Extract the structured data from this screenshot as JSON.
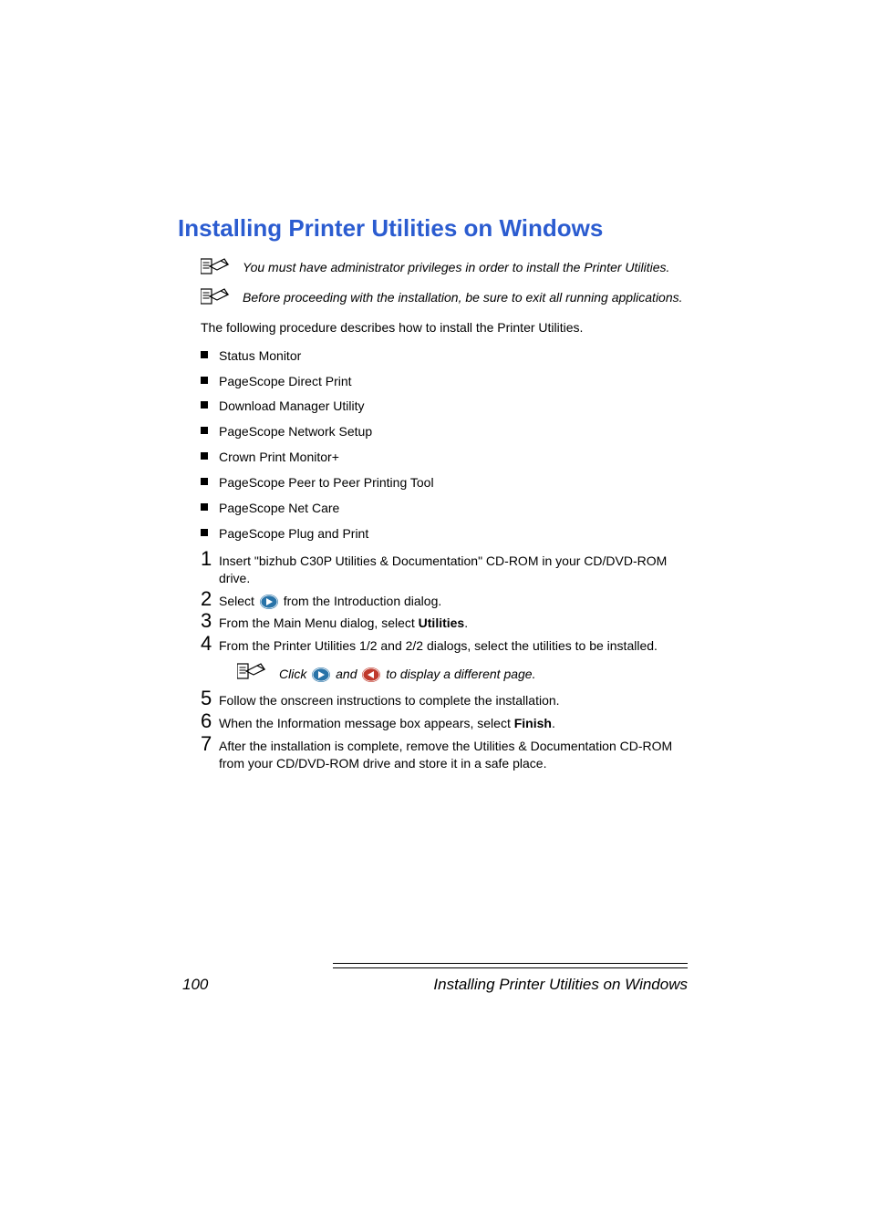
{
  "heading": "Installing Printer Utilities on Windows",
  "notes": {
    "note1": "You must have administrator privileges in order to install the Printer Utilities.",
    "note2": "Before proceeding with the installation, be sure to exit all running applications."
  },
  "desc": "The following procedure describes how to install the Printer Utilities.",
  "bullets": [
    "Status Monitor",
    "PageScope Direct Print",
    "Download Manager Utility",
    "PageScope Network Setup",
    "Crown Print Monitor+",
    "PageScope Peer to Peer Printing Tool",
    "PageScope Net Care",
    "PageScope Plug and Print"
  ],
  "steps": {
    "s1": "Insert \"bizhub C30P Utilities & Documentation\" CD-ROM in your CD/DVD-ROM drive.",
    "s2a": "Select ",
    "s2b": " from the Introduction dialog.",
    "s3a": "From the Main Menu dialog, select ",
    "s3b": "Utilities",
    "s3c": ".",
    "s4": "From the Printer Utilities 1/2 and 2/2 dialogs, select the utilities to be installed.",
    "s4note_a": "Click ",
    "s4note_b": " and ",
    "s4note_c": " to display a different page.",
    "s5": "Follow the onscreen instructions to complete the installation.",
    "s6a": "When the Information message box appears, select ",
    "s6b": "Finish",
    "s6c": ".",
    "s7": "After the installation is complete, remove the Utilities & Documentation CD-ROM from your CD/DVD-ROM drive and store it in a safe place."
  },
  "nums": {
    "n1": "1",
    "n2": "2",
    "n3": "3",
    "n4": "4",
    "n5": "5",
    "n6": "6",
    "n7": "7"
  },
  "footer": {
    "page": "100",
    "title": "Installing Printer Utilities on Windows"
  }
}
